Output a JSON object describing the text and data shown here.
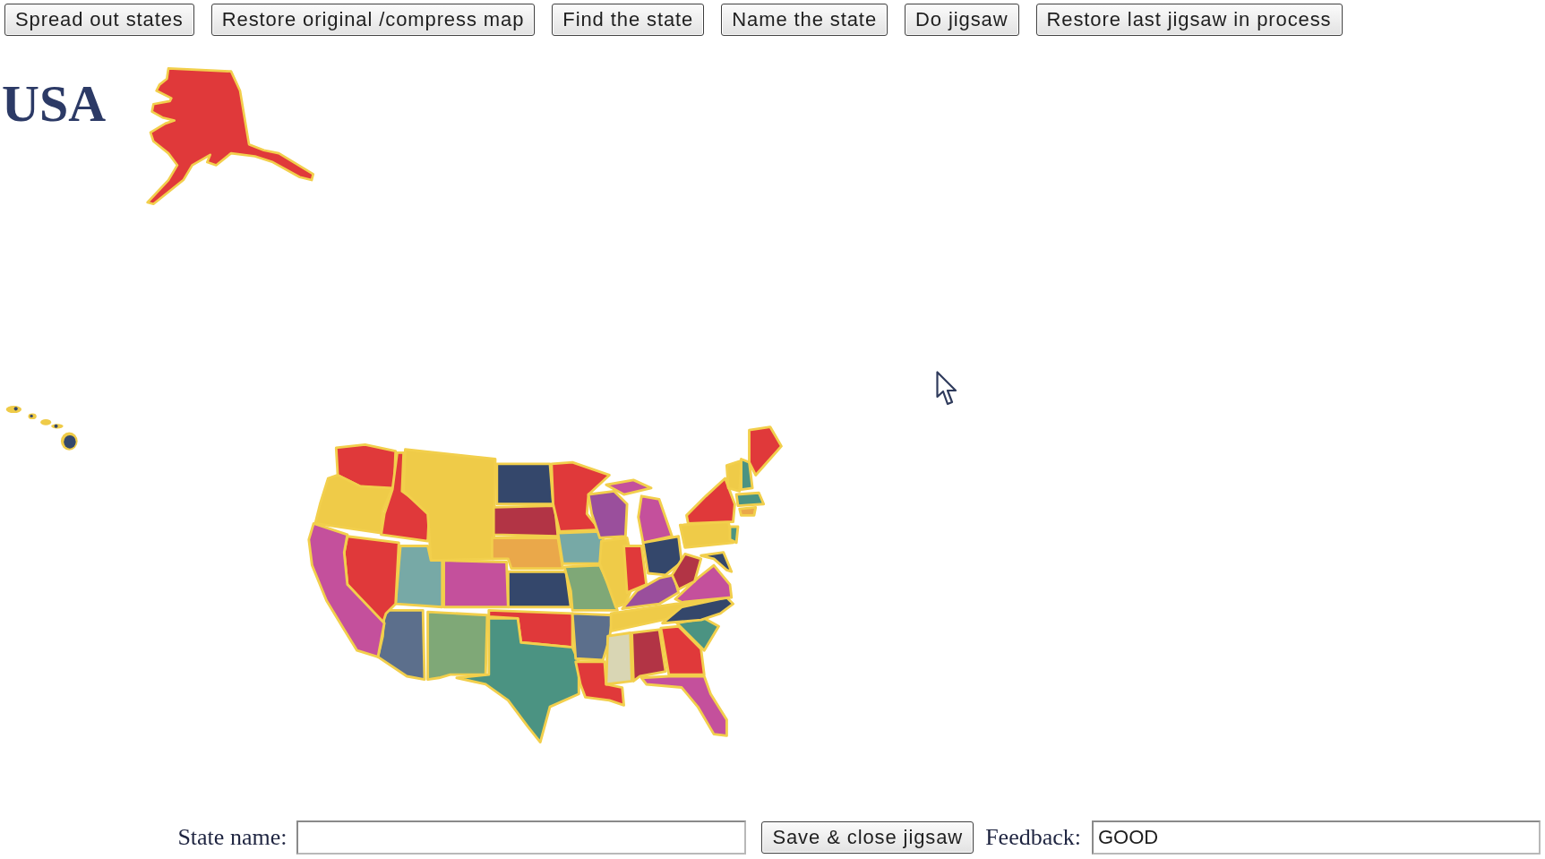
{
  "toolbar": {
    "buttons": [
      "Spread out states",
      "Restore original /compress map",
      "Find the state",
      "Name the state",
      "Do jigsaw",
      "Restore last jigsaw in process"
    ]
  },
  "title": "USA",
  "form": {
    "state_name": {
      "label": "State name:"
    },
    "save_button": "Save & close jigsaw",
    "feedback": {
      "label": "Feedback:",
      "value": "GOOD"
    }
  }
}
